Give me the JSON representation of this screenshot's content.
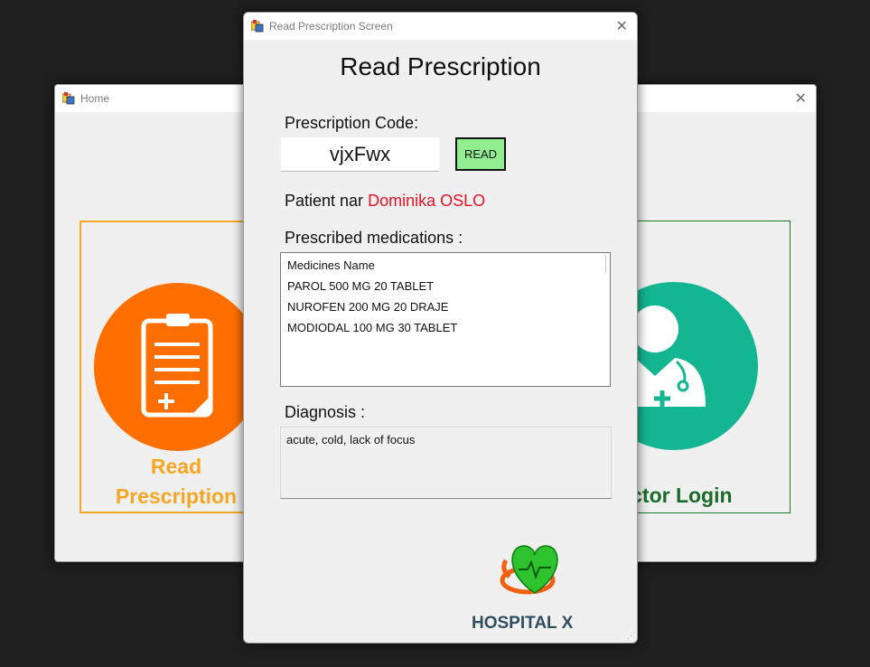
{
  "home_window": {
    "title": "Home",
    "cards": {
      "read": {
        "label_line1": "Read",
        "label_line2": "Prescription"
      },
      "doctor": {
        "label": "Doctor Login"
      }
    }
  },
  "prescription_window": {
    "title": "Read Prescription Screen",
    "heading": "Read Prescription",
    "code_label": "Prescription Code:",
    "code_value": "vjxFwx",
    "read_button": "READ",
    "patient_prefix": "Patient nar",
    "patient_name": "Dominika OSLO",
    "medications_label": "Prescribed medications :",
    "medications_header": "Medicines Name",
    "medications": [
      "PAROL 500 MG 20 TABLET",
      "NUROFEN 200 MG 20 DRAJE",
      "MODIODAL 100 MG 30 TABLET"
    ],
    "diagnosis_label": "Diagnosis :",
    "diagnosis_value": "acute, cold, lack of focus",
    "hospital_name": "HOSPITAL X"
  },
  "colors": {
    "accent_orange": "#ff6f00",
    "accent_teal": "#14b591",
    "read_button_bg": "#90ee90",
    "patient_name": "#e81123"
  }
}
